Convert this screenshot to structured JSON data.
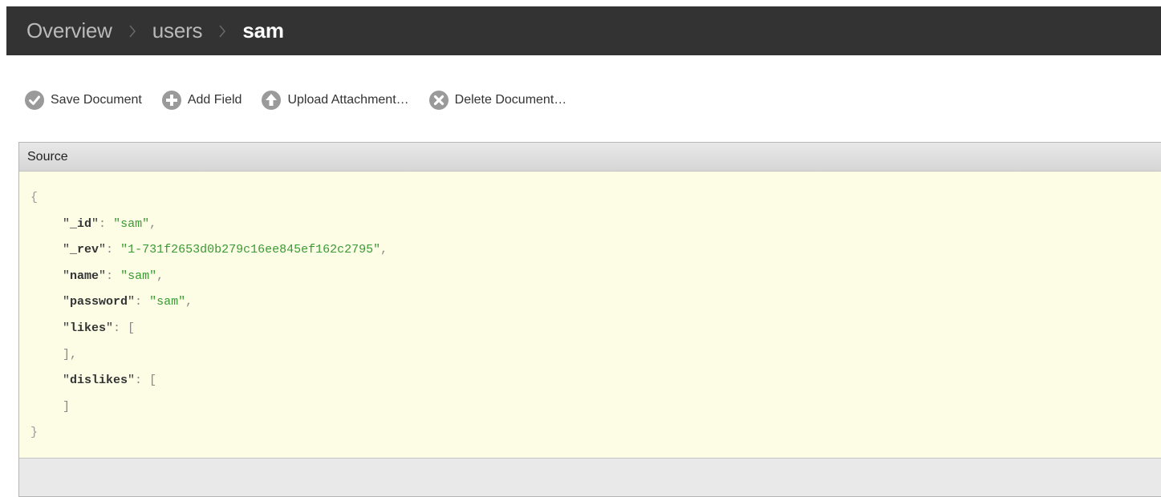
{
  "breadcrumb": {
    "items": [
      "Overview",
      "users"
    ],
    "current": "sam"
  },
  "toolbar": {
    "save": "Save Document",
    "add_field": "Add Field",
    "upload": "Upload Attachment…",
    "delete": "Delete Document…"
  },
  "panel": {
    "title": "Source"
  },
  "document": {
    "id_key": "_id",
    "id_value": "sam",
    "rev_key": "_rev",
    "rev_value": "1-731f2653d0b279c16ee845ef162c2795",
    "name_key": "name",
    "name_value": "sam",
    "password_key": "password",
    "password_value": "sam",
    "likes_key": "likes",
    "dislikes_key": "dislikes"
  },
  "colors": {
    "topbar": "#333333",
    "editor_bg": "#fdfde6",
    "string": "#3a9a34",
    "icon": "#9a9a9a"
  }
}
